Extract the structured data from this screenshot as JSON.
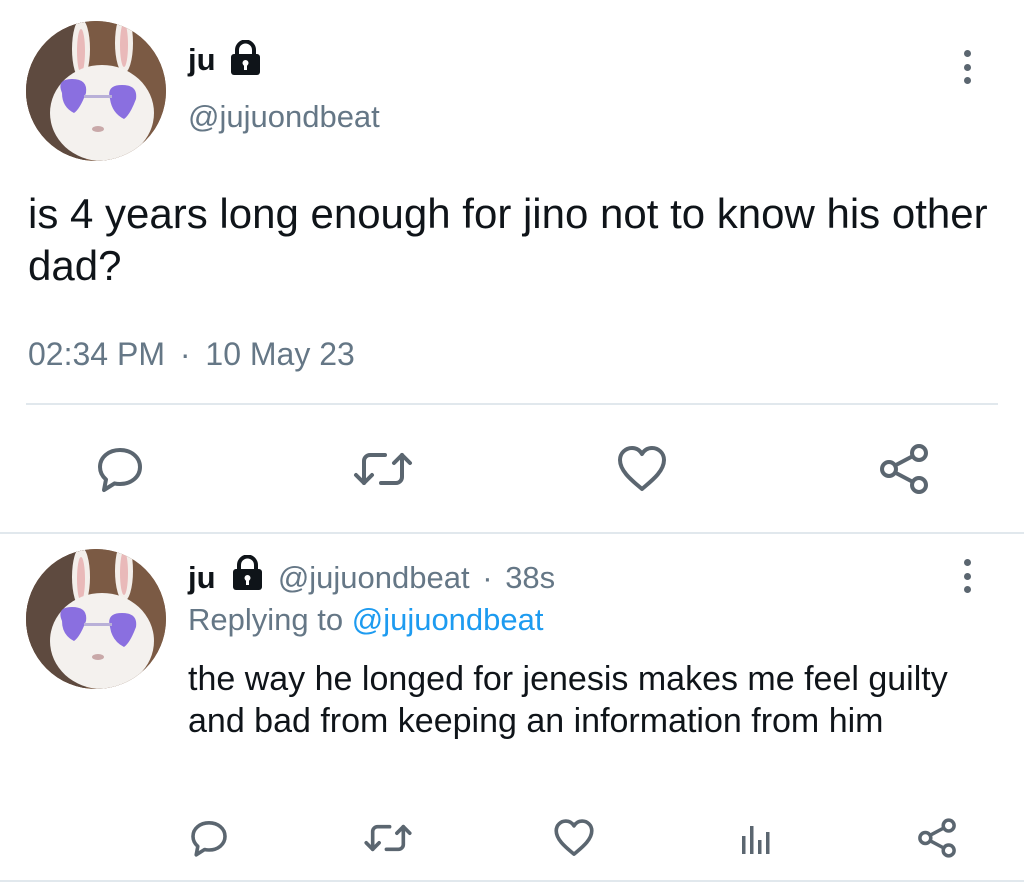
{
  "main_tweet": {
    "display_name": "ju",
    "handle": "@jujuondbeat",
    "text": "is 4 years long enough for jino not to know his other dad?",
    "time": "02:34 PM",
    "separator": "·",
    "date": "10 May 23",
    "icons": {
      "lock": "lock-icon",
      "more": "more-vertical-icon",
      "reply": "reply-icon",
      "retweet": "retweet-icon",
      "like": "heart-icon",
      "share": "share-icon"
    }
  },
  "reply_tweet": {
    "display_name": "ju",
    "handle": "@jujuondbeat",
    "separator": "·",
    "age": "38s",
    "replying_to_prefix": "Replying to",
    "replying_to_handle": "@jujuondbeat",
    "text": "the way he longed for jenesis makes me feel guilty and bad from keeping an information from him",
    "icons": {
      "lock": "lock-icon",
      "more": "more-vertical-icon",
      "reply": "reply-icon",
      "retweet": "retweet-icon",
      "like": "heart-icon",
      "analytics": "analytics-icon",
      "share": "share-icon"
    }
  },
  "colors": {
    "text": "#0f1419",
    "muted": "#657786",
    "link": "#1d9bf0",
    "icon": "#5b6670",
    "divider": "#e1e8ed"
  }
}
